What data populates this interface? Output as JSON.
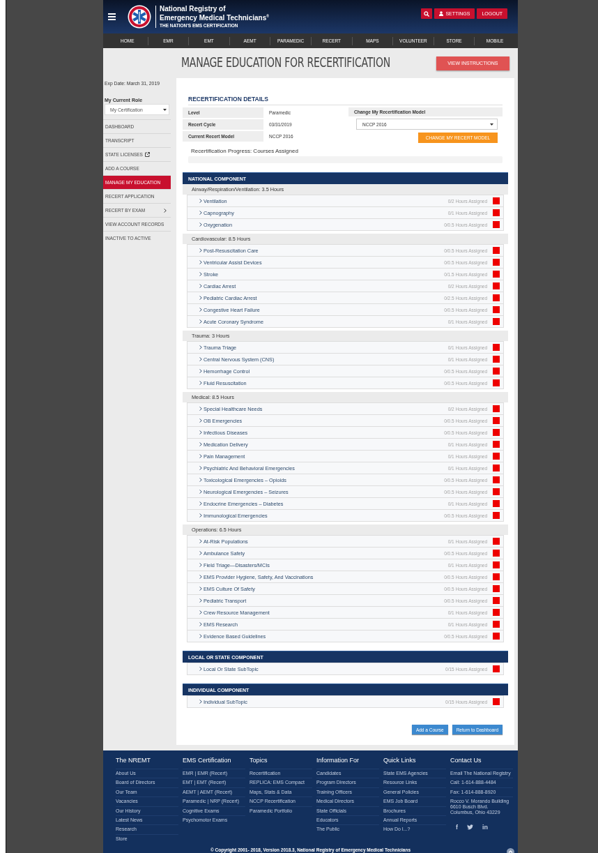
{
  "header": {
    "logo_line1": "National Registry of",
    "logo_line2": "Emergency Medical Technicians$^{®}$",
    "tagline": "THE NATION'S EMS CERTIFICATION",
    "buttons": [
      {
        "kind": "search"
      },
      {
        "kind": "settings",
        "label": "SETTINGS"
      },
      {
        "kind": "plain",
        "label": "LOGOUT"
      }
    ]
  },
  "nav": [
    "HOME",
    "EMR",
    "EMT",
    "AEMT",
    "PARAMEDIC",
    "RECERT",
    "MAPS",
    "VOLUNTEER",
    "STORE",
    "MOBILE"
  ],
  "page_title": "MANAGE EDUCATION FOR RECERTIFICATION",
  "instructions_button": "VIEW INSTRUCTIONS",
  "sidebar": {
    "exp_date": "Exp Date: March 31, 2019",
    "role_label": "My Current Role",
    "role_value": "My Certification",
    "items": [
      {
        "label": "DASHBOARD",
        "kind": "plain",
        "selected": false
      },
      {
        "label": "TRANSCRIPT",
        "kind": "plain",
        "selected": false
      },
      {
        "label": "STATE LICENSES",
        "kind": "external",
        "selected": false
      },
      {
        "label": "ADD A COURSE",
        "kind": "plain",
        "selected": false
      },
      {
        "label": "MANAGE MY EDUCATION",
        "kind": "plain",
        "selected": true
      },
      {
        "label": "RECERT APPLICATION",
        "kind": "plain",
        "selected": false
      },
      {
        "label": "RECERT BY EXAM",
        "kind": "submenu",
        "selected": false
      },
      {
        "label": "VIEW ACCOUNT RECORDS",
        "kind": "plain",
        "selected": false
      },
      {
        "label": "INACTIVE TO ACTIVE",
        "kind": "plain",
        "selected": false
      }
    ]
  },
  "details": {
    "title": "RECERTIFICATION DETAILS",
    "fields": [
      {
        "label": "Level",
        "value": "Paramedic"
      },
      {
        "label": "Recert Cycle",
        "value": "03/31/2019"
      },
      {
        "label": "Current Recert Model",
        "value": "NCCP 2016"
      }
    ],
    "change_label": "Change My Recertification Model",
    "model_select": "NCCP 2016",
    "change_button": "CHANGE MY RECERT MODEL",
    "progress": {
      "label": "Recertification Progress: Courses Assigned",
      "level": 0
    }
  },
  "components": [
    {
      "title": "NATIONAL COMPONENT",
      "categories": [
        {
          "title": "Airway/Respiration/Ventilation: 3.5 Hours",
          "topics": [
            {
              "name": "Ventilation",
              "hours": "0/2 Hours Assigned",
              "complete": false
            },
            {
              "name": "Capnography",
              "hours": "0/1 Hours Assigned",
              "complete": false
            },
            {
              "name": "Oxygenation",
              "hours": "0/0.5 Hours Assigned",
              "complete": false
            }
          ]
        },
        {
          "title": "Cardiovascular: 8.5 Hours",
          "topics": [
            {
              "name": "Post-Resuscitation Care",
              "hours": "0/0.5 Hours Assigned",
              "complete": false
            },
            {
              "name": "Ventricular Assist Devices",
              "hours": "0/0.5 Hours Assigned",
              "complete": false
            },
            {
              "name": "Stroke",
              "hours": "0/1.5 Hours Assigned",
              "complete": false
            },
            {
              "name": "Cardiac Arrest",
              "hours": "0/2 Hours Assigned",
              "complete": false
            },
            {
              "name": "Pediatric Cardiac Arrest",
              "hours": "0/2.5 Hours Assigned",
              "complete": false
            },
            {
              "name": "Congestive Heart Failure",
              "hours": "0/0.5 Hours Assigned",
              "complete": false
            },
            {
              "name": "Acute Coronary Syndrome",
              "hours": "0/1 Hours Assigned",
              "complete": false
            }
          ]
        },
        {
          "title": "Trauma: 3 Hours",
          "topics": [
            {
              "name": "Trauma Triage",
              "hours": "0/1 Hours Assigned",
              "complete": false
            },
            {
              "name": "Central Nervous System (CNS)",
              "hours": "0/1 Hours Assigned",
              "complete": false
            },
            {
              "name": "Hemorrhage Control",
              "hours": "0/0.5 Hours Assigned",
              "complete": false
            },
            {
              "name": "Fluid Resuscitation",
              "hours": "0/0.5 Hours Assigned",
              "complete": false
            }
          ]
        },
        {
          "title": "Medical: 8.5 Hours",
          "topics": [
            {
              "name": "Special Healthcare Needs",
              "hours": "0/2 Hours Assigned",
              "complete": false
            },
            {
              "name": "OB Emergencies",
              "hours": "0/0.5 Hours Assigned",
              "complete": false
            },
            {
              "name": "Infectious Diseases",
              "hours": "0/0.5 Hours Assigned",
              "complete": false
            },
            {
              "name": "Medication Delivery",
              "hours": "0/1 Hours Assigned",
              "complete": false
            },
            {
              "name": "Pain Management",
              "hours": "0/1 Hours Assigned",
              "complete": false
            },
            {
              "name": "Psychiatric And Behavioral Emergencies",
              "hours": "0/1 Hours Assigned",
              "complete": false
            },
            {
              "name": "Toxicological Emergencies – Opioids",
              "hours": "0/0.5 Hours Assigned",
              "complete": false
            },
            {
              "name": "Neurological Emergencies – Seizures",
              "hours": "0/0.5 Hours Assigned",
              "complete": false
            },
            {
              "name": "Endocrine Emergencies – Diabetes",
              "hours": "0/1 Hours Assigned",
              "complete": false
            },
            {
              "name": "Immunological Emergencies",
              "hours": "0/0.5 Hours Assigned",
              "complete": false
            }
          ]
        },
        {
          "title": "Operations: 6.5 Hours",
          "topics": [
            {
              "name": "At-Risk Populations",
              "hours": "0/1 Hours Assigned",
              "complete": false
            },
            {
              "name": "Ambulance Safety",
              "hours": "0/0.5 Hours Assigned",
              "complete": false
            },
            {
              "name": "Field Triage—Disasters/MCIs",
              "hours": "0/1 Hours Assigned",
              "complete": false
            },
            {
              "name": "EMS Provider Hygiene, Safety, And Vaccinations",
              "hours": "0/0.5 Hours Assigned",
              "complete": false
            },
            {
              "name": "EMS Culture Of Safety",
              "hours": "0/0.5 Hours Assigned",
              "complete": false
            },
            {
              "name": "Pediatric Transport",
              "hours": "0/0.5 Hours Assigned",
              "complete": false
            },
            {
              "name": "Crew Resource Management",
              "hours": "0/1 Hours Assigned",
              "complete": false
            },
            {
              "name": "EMS Research",
              "hours": "0/1 Hours Assigned",
              "complete": false
            },
            {
              "name": "Evidence Based Guidelines",
              "hours": "0/0.5 Hours Assigned",
              "complete": false
            }
          ]
        }
      ]
    },
    {
      "title": "LOCAL OR STATE COMPONENT",
      "categories": [
        {
          "topics": [
            {
              "name": "Local Or State SubTopic",
              "hours": "0/15 Hours Assigned",
              "complete": false
            }
          ]
        }
      ]
    },
    {
      "title": "INDIVIDUAL COMPONENT",
      "categories": [
        {
          "topics": [
            {
              "name": "Individual SubTopic",
              "hours": "0/15 Hours Assigned",
              "complete": false
            }
          ]
        }
      ]
    }
  ],
  "actions": [
    "Add a Course",
    "Return to Dashboard"
  ],
  "footer": {
    "columns": [
      {
        "title": "The NREMT",
        "links": [
          "About Us",
          "Board of Directors",
          "Our Team",
          "Vacancies",
          "Our History",
          "Latest News",
          "Research",
          "Store"
        ]
      },
      {
        "title": "EMS Certification",
        "links": [
          "EMR | EMR (Recert)",
          "EMT | EMT (Recert)",
          "AEMT | AEMT (Recert)",
          "Paramedic | NRP (Recert)",
          "Cognitive Exams",
          "Psychomotor Exams"
        ]
      },
      {
        "title": "Topics",
        "links": [
          "Recertification",
          "REPLICA: EMS Compact",
          "Maps, Stats & Data",
          "NCCP Recertification",
          "Paramedic Portfolio"
        ]
      },
      {
        "title": "Information For",
        "links": [
          "Candidates",
          "Program Directors",
          "Training Officers",
          "Medical Directors",
          "State Officials",
          "Educators",
          "The Public"
        ]
      },
      {
        "title": "Quick Links",
        "links": [
          "State EMS Agencies",
          "Resource Links",
          "General Policies",
          "EMS Job Board",
          "Brochures",
          "Annual Reports",
          "How Do I...?"
        ]
      },
      {
        "title": "Contact Us",
        "links": [
          "Email The National Registry",
          "Call: 1-614-888-4484",
          "Fax: 1-614-888-8920",
          "Rocco V. Morando Building\n6610 Busch Blvd.\nColumbus, Ohio 43229"
        ]
      }
    ],
    "social": [
      {
        "kind": "text",
        "text": "f"
      },
      {
        "kind": "bird"
      },
      {
        "kind": "text",
        "text": "in"
      }
    ],
    "copyright": "© Copyright 2001- 2018, Version 2018.3, National Registry of Emergency Medical Technicians"
  }
}
